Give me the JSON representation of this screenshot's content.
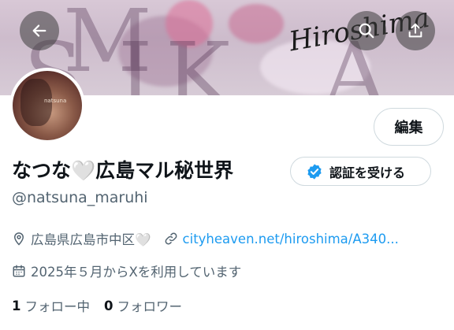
{
  "banner": {
    "overlay_text": "Hiroshima",
    "letters": [
      "M",
      "S",
      "I",
      "K",
      "A"
    ]
  },
  "top_bar": {
    "back_icon": "arrow-left-icon",
    "search_icon": "search-icon",
    "share_icon": "share-upload-icon"
  },
  "profile": {
    "avatar_tag": "natsuna",
    "edit_label": "編集",
    "display_name": "なつな",
    "display_name_heart": "🤍",
    "display_name_rest": "広島マル秘世界",
    "verify_label": "認証を受ける",
    "verify_icon": "verified-badge-icon",
    "handle": "@natsuna_maruhi",
    "location": "広島県広島市中区🤍",
    "location_icon": "location-pin-icon",
    "link": "cityheaven.net/hiroshima/A340...",
    "link_icon": "link-icon",
    "joined": "2025年５月からXを利用しています",
    "joined_icon": "calendar-icon",
    "following_count": "1",
    "following_label": "フォロー中",
    "followers_count": "0",
    "followers_label": "フォロワー"
  },
  "colors": {
    "accent": "#1d9bf0",
    "secondary_text": "#536471",
    "primary_text": "#0f1419",
    "border": "#cfd9de"
  }
}
